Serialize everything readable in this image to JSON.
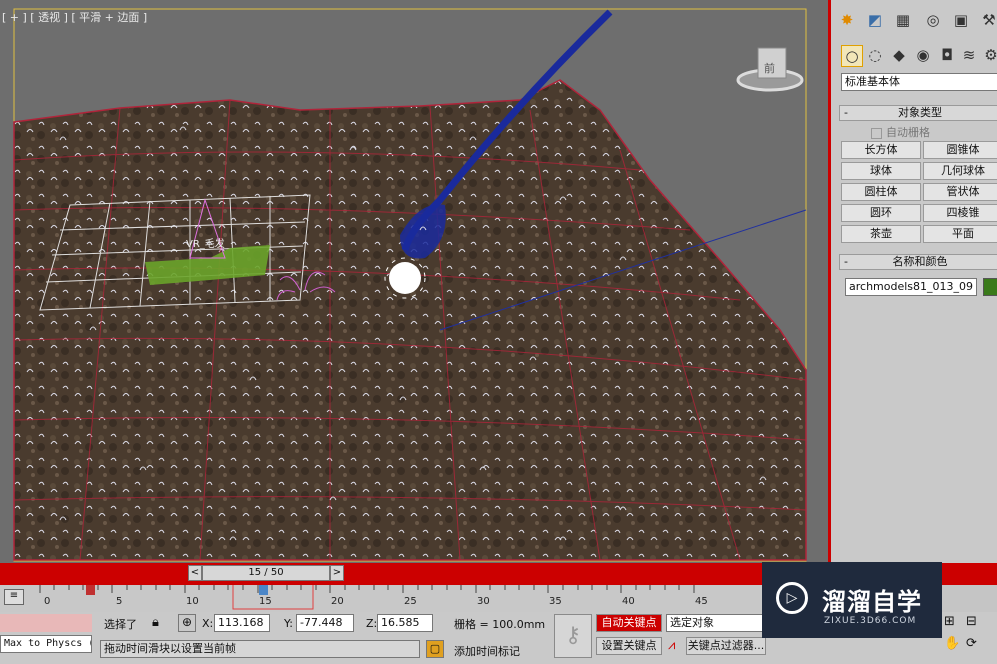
{
  "viewport": {
    "label": "[ + ] [ 透视 ] [ 平滑 + 边面 ]",
    "object_label": "VR_毛发",
    "viewcube_face": "前",
    "colors": {
      "background": "#6e6e6e",
      "terrain": "#4a3b2e",
      "grid": "#b0243a",
      "hair": "#d9d9e6",
      "wire": "#1a2a9c",
      "patch": "#6aa42a"
    }
  },
  "command_panel": {
    "tab_icons": [
      "create-icon",
      "modify-icon",
      "hierarchy-icon",
      "motion-icon",
      "display-icon",
      "utilities-icon"
    ],
    "subtab_icons": [
      "geometry-icon",
      "shapes-icon",
      "lights-icon",
      "cameras-icon",
      "helpers-icon",
      "spacewarps-icon",
      "systems-icon"
    ],
    "category_dropdown": "标准基本体",
    "object_type": {
      "title": "对象类型",
      "autogrid": "自动栅格",
      "buttons": [
        "长方体",
        "圆锥体",
        "球体",
        "几何球体",
        "圆柱体",
        "管状体",
        "圆环",
        "四棱锥",
        "茶壶",
        "平面"
      ]
    },
    "name_color": {
      "title": "名称和颜色",
      "name_value": "archmodels81_013_09",
      "swatch": "#3a7a1a"
    }
  },
  "timeline": {
    "frame_display": "15 / 50",
    "prev": "<",
    "next": ">",
    "ticks": [
      "0",
      "5",
      "10",
      "15",
      "20",
      "25",
      "30",
      "35",
      "40",
      "45"
    ]
  },
  "status": {
    "script_listener": "Max to Physcs (",
    "selected": "选择了",
    "x_label": "X:",
    "x_value": "113.168",
    "y_label": "Y:",
    "y_value": "-77.448",
    "z_label": "Z:",
    "z_value": "16.585",
    "grid": "栅格 = 100.0mm",
    "prompt": "拖动时间滑块以设置当前帧",
    "add_time_tag": "添加时间标记",
    "auto_key": "自动关键点",
    "set_key": "设置关键点",
    "selection_set": "选定对象",
    "key_filters": "关键点过滤器...",
    "auto_key_color": "#cc0000"
  },
  "watermark": {
    "title": "溜溜自学",
    "subtitle": "ZIXUE.3D66.COM"
  }
}
